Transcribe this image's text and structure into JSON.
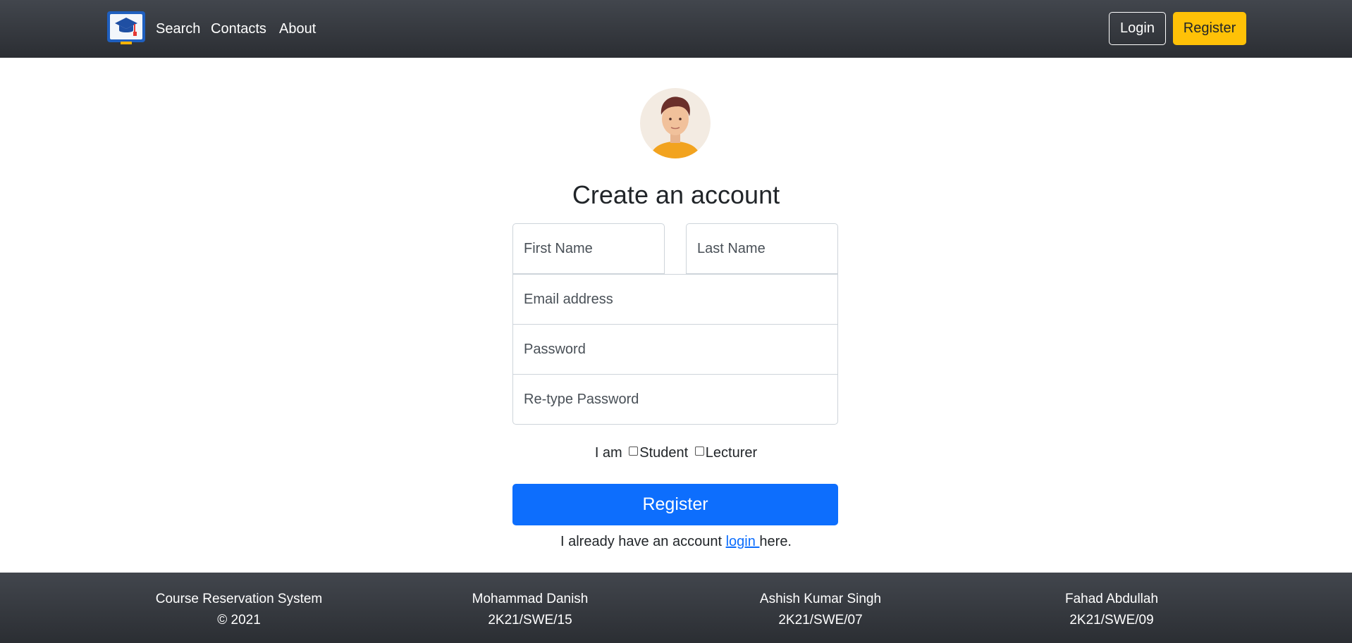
{
  "navbar": {
    "links": [
      "Search",
      "Contacts",
      "About"
    ],
    "login_label": "Login",
    "register_label": "Register",
    "register_color": "#ffc107"
  },
  "form": {
    "title": "Create an account",
    "first_name_placeholder": "First Name",
    "last_name_placeholder": "Last Name",
    "email_placeholder": "Email address",
    "password_placeholder": "Password",
    "retype_password_placeholder": "Re-type Password",
    "iam_label": "I am",
    "role_student": "Student",
    "role_lecturer": "Lecturer",
    "submit_label": "Register",
    "submit_color": "#0d6efd",
    "already_prefix": "I already have an account",
    "login_link": "login ",
    "already_suffix": "here."
  },
  "footer": {
    "columns": [
      {
        "line1": "Course Reservation System",
        "line2": "© 2021"
      },
      {
        "line1": "Mohammad Danish",
        "line2": "2K21/SWE/15"
      },
      {
        "line1": "Ashish Kumar Singh",
        "line2": "2K21/SWE/07"
      },
      {
        "line1": "Fahad Abdullah",
        "line2": "2K21/SWE/09"
      }
    ]
  }
}
